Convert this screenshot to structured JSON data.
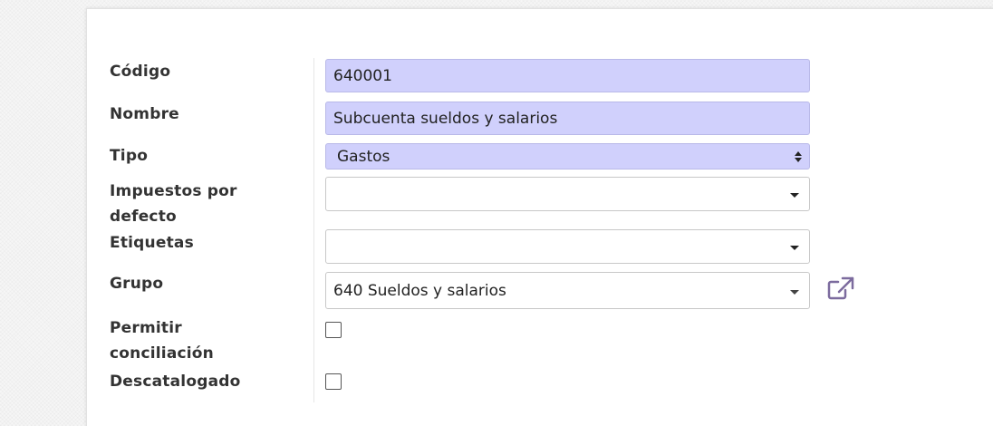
{
  "form": {
    "codigo": {
      "label": "Código",
      "value": "640001"
    },
    "nombre": {
      "label": "Nombre",
      "value": "Subcuenta sueldos y salarios"
    },
    "tipo": {
      "label": "Tipo",
      "value": "Gastos"
    },
    "impuestos": {
      "label_line1": "Impuestos por",
      "label_line2": "defecto",
      "value": ""
    },
    "etiquetas": {
      "label": "Etiquetas",
      "value": ""
    },
    "grupo": {
      "label": "Grupo",
      "value": "640 Sueldos y salarios",
      "link_icon": "external-link-icon"
    },
    "permitir": {
      "label_line1": "Permitir",
      "label_line2": "conciliación",
      "checked": false
    },
    "descatalogado": {
      "label": "Descatalogado",
      "checked": false
    }
  },
  "colors": {
    "required_field_bg": "#d0d0fc",
    "link_icon": "#7c6b9e"
  }
}
